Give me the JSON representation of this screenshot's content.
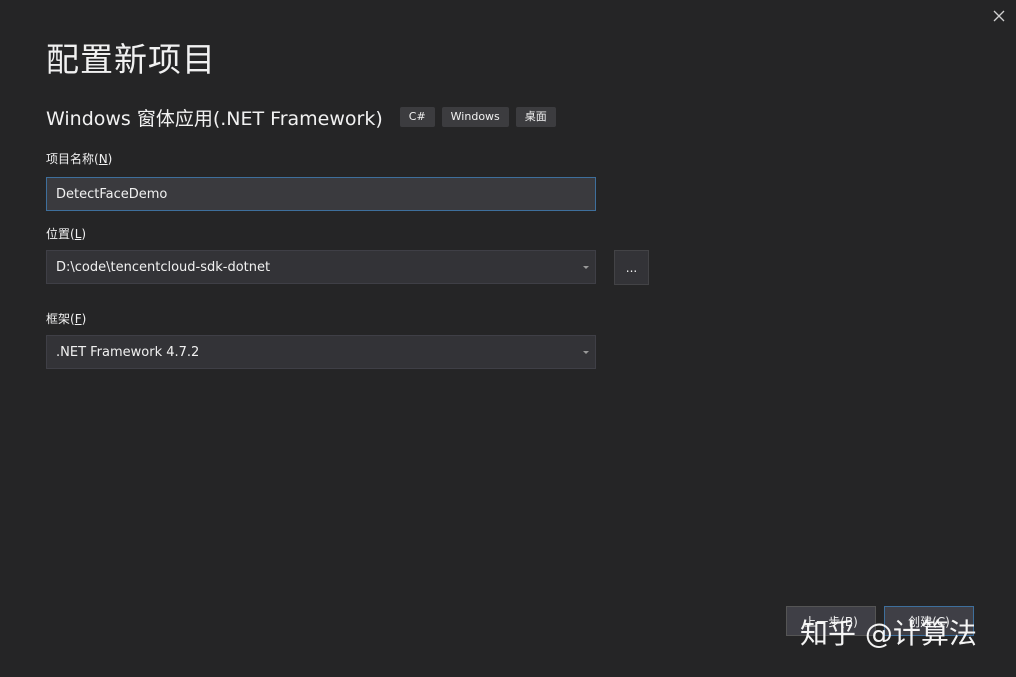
{
  "dialog": {
    "title": "配置新项目",
    "close_icon": "close-icon"
  },
  "template": {
    "name": "Windows 窗体应用(.NET Framework)",
    "tags": [
      "C#",
      "Windows",
      "桌面"
    ]
  },
  "project_name": {
    "label_text": "项目名称(",
    "label_key": "N",
    "label_end": ")",
    "value": "DetectFaceDemo"
  },
  "location": {
    "label_text": "位置(",
    "label_key": "L",
    "label_end": ")",
    "value": "D:\\code\\tencentcloud-sdk-dotnet",
    "browse_label": "..."
  },
  "framework": {
    "label_text": "框架(",
    "label_key": "F",
    "label_end": ")",
    "value": ".NET Framework 4.7.2"
  },
  "footer": {
    "back_label": "上一步(B)",
    "create_label": "创建(C)"
  },
  "watermark": "知乎 @计算法"
}
